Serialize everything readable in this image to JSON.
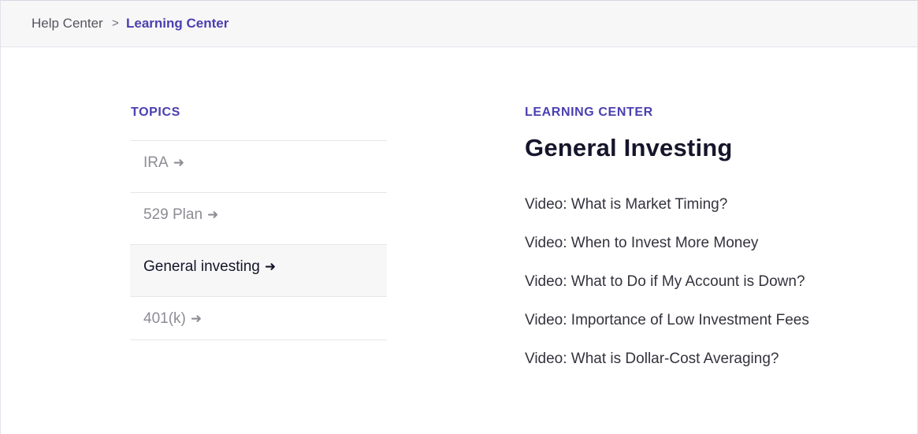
{
  "breadcrumb": {
    "home": "Help Center",
    "separator": ">",
    "current": "Learning Center"
  },
  "topics": {
    "heading": "TOPICS",
    "arrow_glyph": "➜",
    "items": [
      {
        "label": "IRA",
        "active": false
      },
      {
        "label": "529 Plan",
        "active": false
      },
      {
        "label": "General investing",
        "active": true
      },
      {
        "label": "401(k)",
        "active": false
      }
    ]
  },
  "section": {
    "eyebrow": "LEARNING CENTER",
    "title": "General Investing",
    "articles": [
      "Video: What is Market Timing?",
      "Video: When to Invest More Money",
      "Video: What to Do if My Account is Down?",
      "Video: Importance of Low Investment Fees",
      "Video: What is Dollar-Cost Averaging?"
    ]
  },
  "colors": {
    "accent": "#4a3fb0",
    "text_dark": "#15152b",
    "text_muted": "#8c8c94",
    "breadcrumb_bg": "#f7f7f8"
  }
}
